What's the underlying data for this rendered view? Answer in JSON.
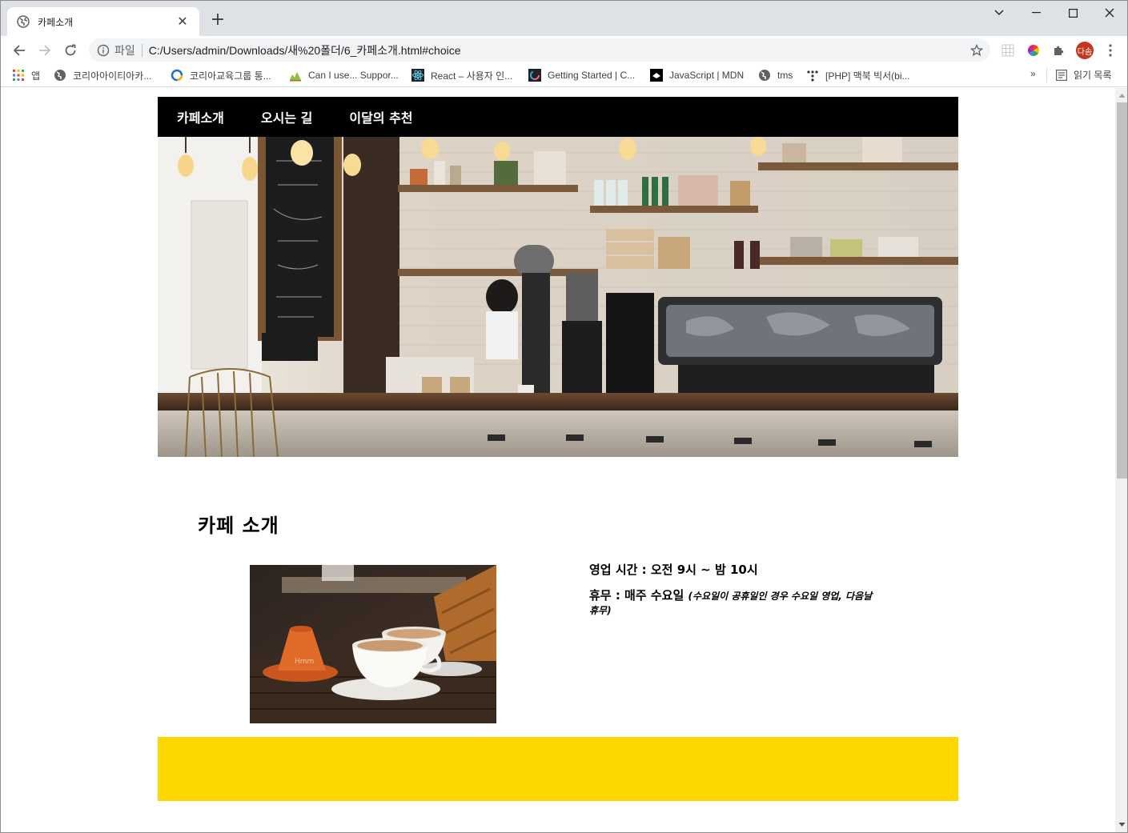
{
  "browser": {
    "tab_title": "카페소개",
    "new_tab_symbol": "+",
    "scheme_label": "파일",
    "url": "C:/Users/admin/Downloads/새%20폴더/6_카페소개.html#choice",
    "profile_initials": "다솜",
    "bookmarks": [
      {
        "label": "앱",
        "icon": "apps-grid-icon"
      },
      {
        "label": "코리아아이티아카...",
        "icon": "globe-icon"
      },
      {
        "label": "코리아교육그룹 통...",
        "icon": "ring-icon"
      },
      {
        "label": "Can I use... Suppor...",
        "icon": "caniuse-icon"
      },
      {
        "label": "React – 사용자 인...",
        "icon": "react-icon"
      },
      {
        "label": "Getting Started | C...",
        "icon": "chart-icon"
      },
      {
        "label": "JavaScript | MDN",
        "icon": "mdn-icon"
      },
      {
        "label": "tms",
        "icon": "globe-icon"
      },
      {
        "label": "[PHP] 맥북 빅서(bi...",
        "icon": "dots-icon"
      }
    ],
    "bookmarks_overflow": "»",
    "reading_list_label": "읽기 목록",
    "colors": {
      "tabstrip": "#dee1e6",
      "omnibox": "#f1f3f4",
      "avatar": "#c5381f"
    }
  },
  "site": {
    "nav": [
      "카페소개",
      "오시는 길",
      "이달의 추천"
    ],
    "intro": {
      "title": "카페 소개",
      "hours": "영업 시간 : 오전 9시 ~ 밤 10시",
      "holiday": "휴무 : 매주 수요일",
      "holiday_note": "(수요일이 공휴일인 경우 수요일 영업, 다음날 휴무)"
    },
    "colors": {
      "nav_bg": "#000000",
      "band": "#ffd700"
    }
  }
}
